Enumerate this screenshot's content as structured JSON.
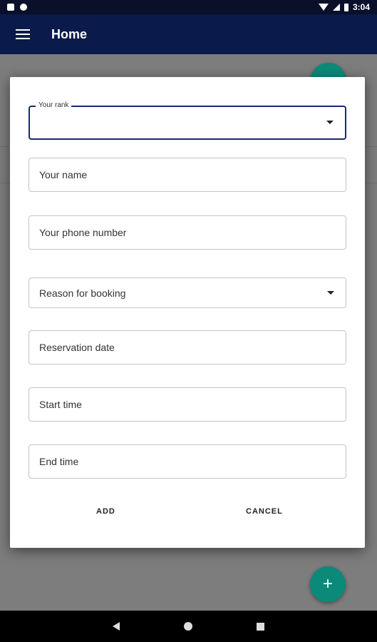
{
  "status_bar": {
    "time": "3:04"
  },
  "app_bar": {
    "title": "Home"
  },
  "dialog": {
    "rank_label": "Your rank",
    "name_placeholder": "Your name",
    "phone_placeholder": "Your phone number",
    "reason_placeholder": "Reason for booking",
    "date_placeholder": "Reservation date",
    "start_time_placeholder": "Start time",
    "end_time_placeholder": "End time",
    "add_label": "ADD",
    "cancel_label": "CANCEL"
  },
  "fab": {
    "label": "+"
  },
  "colors": {
    "app_bar": "#0a1a4a",
    "accent": "#0b8a7a",
    "focus": "#1a2a6c"
  },
  "icons": [
    "menu-icon",
    "dropdown-arrow-icon",
    "add-icon",
    "back-icon",
    "home-icon",
    "recents-icon"
  ]
}
